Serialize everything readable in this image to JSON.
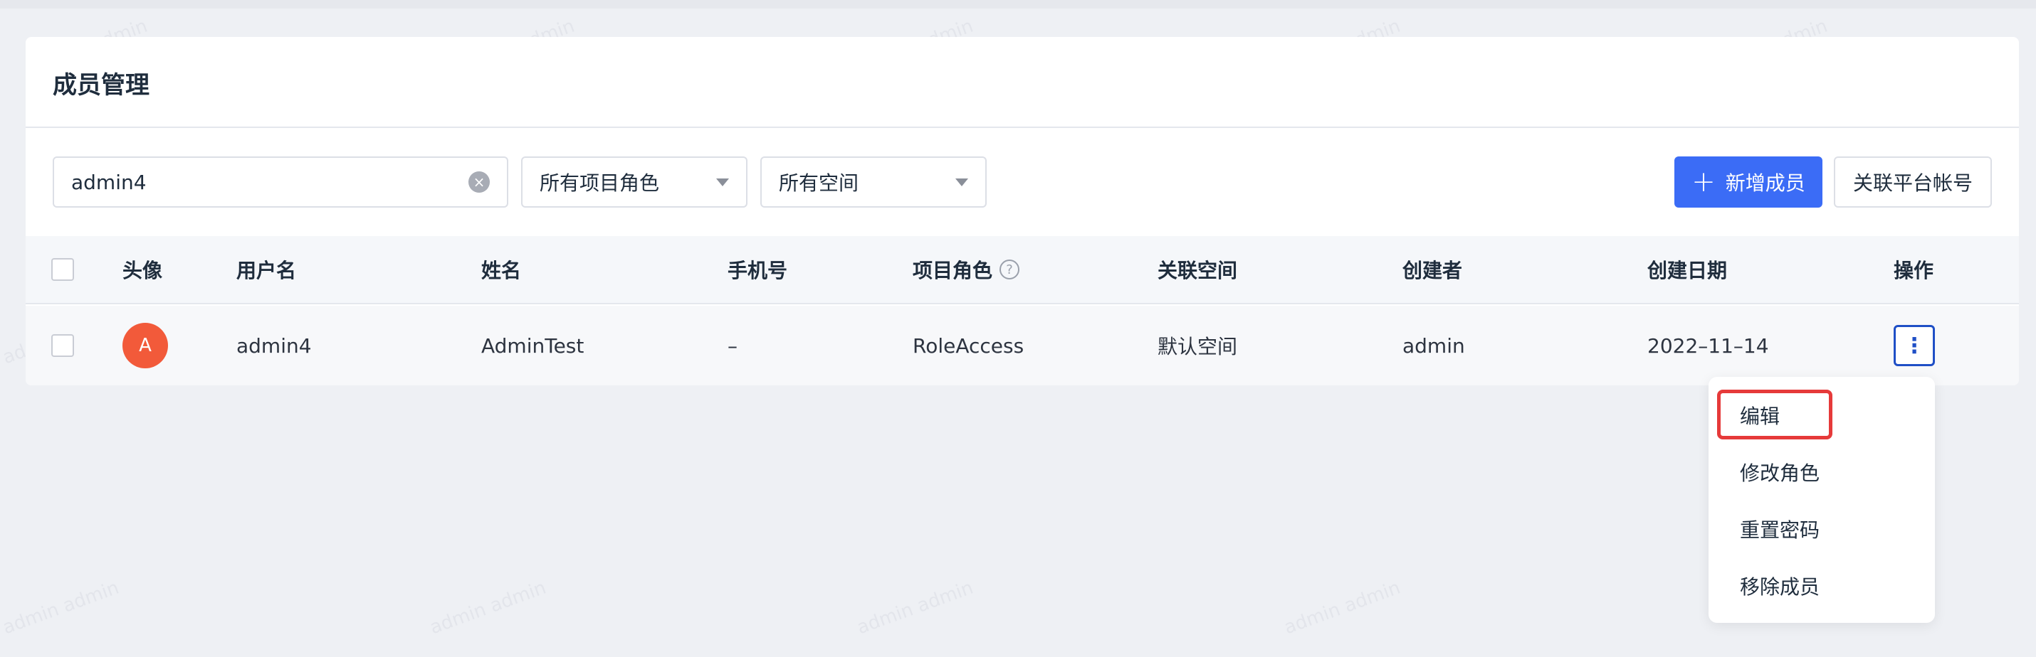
{
  "page": {
    "title": "成员管理"
  },
  "search": {
    "value": "admin4",
    "placeholder": ""
  },
  "filters": {
    "role_select": "所有项目角色",
    "space_select": "所有空间"
  },
  "actions": {
    "add_member": "新增成员",
    "link_account": "关联平台帐号"
  },
  "table": {
    "headers": {
      "avatar": "头像",
      "username": "用户名",
      "name": "姓名",
      "phone": "手机号",
      "role": "项目角色",
      "space": "关联空间",
      "creator": "创建者",
      "created_date": "创建日期",
      "ops": "操作"
    },
    "rows": [
      {
        "avatar_letter": "A",
        "username": "admin4",
        "name": "AdminTest",
        "phone": "–",
        "role": "RoleAccess",
        "space": "默认空间",
        "creator": "admin",
        "created_date": "2022–11–14"
      }
    ]
  },
  "menu": {
    "items": [
      "编辑",
      "修改角色",
      "重置密码",
      "移除成员"
    ]
  },
  "watermark": {
    "text": "admin admin"
  },
  "colors": {
    "primary": "#3b6cf6",
    "avatar": "#f25a3a",
    "highlight": "#e63a3a"
  },
  "icons": {
    "clear": "close-circle-icon",
    "caret": "caret-down-icon",
    "plus": "plus-icon",
    "help": "question-circle-icon",
    "more": "more-vertical-icon"
  }
}
